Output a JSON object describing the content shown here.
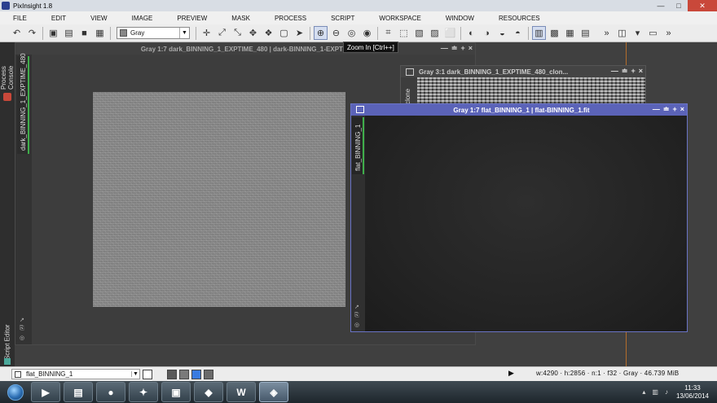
{
  "app": {
    "title": "PixInsight 1.8"
  },
  "window_controls": {
    "minimize": "—",
    "maximize": "□",
    "close": "✕"
  },
  "menu": [
    "FILE",
    "EDIT",
    "VIEW",
    "IMAGE",
    "PREVIEW",
    "MASK",
    "PROCESS",
    "SCRIPT",
    "WORKSPACE",
    "WINDOW",
    "RESOURCES"
  ],
  "toolbar": {
    "colorspace": "Gray",
    "tooltip": "Zoom In [Ctrl++]",
    "more": "»"
  },
  "left_panel": {
    "process_console": "Process Console",
    "script_editor": "Script Editor"
  },
  "windows": {
    "dark": {
      "title": "Gray 1:7 dark_BINNING_1_EXPTIME_480 | dark-BINNING_1-EXPTIME",
      "side_label": "dark_BINNING_1_EXPTIME_480"
    },
    "clone": {
      "title": "Gray 3:1 dark_BINNING_1_EXPTIME_480_clon...",
      "side_label": "clone"
    },
    "flat": {
      "title": "Gray 1:7 flat_BINNING_1 | flat-BINNING_1.fit",
      "side_label": "flat_BINNING_1"
    },
    "buttons": {
      "min": "—",
      "shade": "≐",
      "max": "+",
      "close": "×"
    }
  },
  "statusbar": {
    "view": "flat_BINNING_1",
    "play": "▶",
    "info": "w:4290 · h:2856 · n:1 · f32 · Gray · 46.739 MiB"
  },
  "taskbar": {
    "apps": [
      "▶",
      "▤",
      "●",
      "✦",
      "▣",
      "◆",
      "W",
      "◈"
    ],
    "time": "11:33",
    "date": "13/06/2014"
  }
}
